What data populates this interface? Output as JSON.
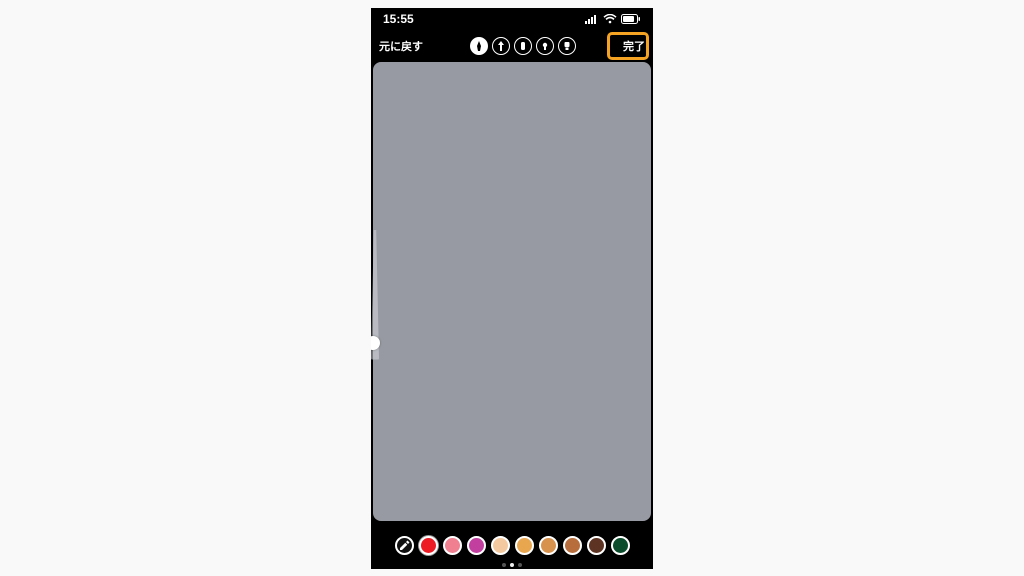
{
  "status": {
    "time": "15:55",
    "signal_icon": "signal",
    "wifi_icon": "wifi",
    "battery_icon": "battery"
  },
  "toolbar": {
    "undo_label": "元に戻す",
    "done_label": "完了",
    "tools": [
      {
        "name": "pen",
        "icon": "pen",
        "selected": true
      },
      {
        "name": "arrow",
        "icon": "arrow",
        "selected": false
      },
      {
        "name": "marker",
        "icon": "marker",
        "selected": false
      },
      {
        "name": "neon",
        "icon": "neon",
        "selected": false
      },
      {
        "name": "eraser",
        "icon": "eraser",
        "selected": false
      }
    ]
  },
  "highlight": {
    "target": "done-button",
    "color": "#f5a322"
  },
  "slider": {
    "value_pct": 92
  },
  "palette": {
    "eyedropper": true,
    "selected_index": 0,
    "colors": [
      "#ed1c24",
      "#f07f90",
      "#c23fa0",
      "#f4c9a0",
      "#e8a64e",
      "#d7924e",
      "#b86e3c",
      "#5d3423",
      "#0a4c2b"
    ],
    "page_count": 3,
    "active_page": 1
  }
}
